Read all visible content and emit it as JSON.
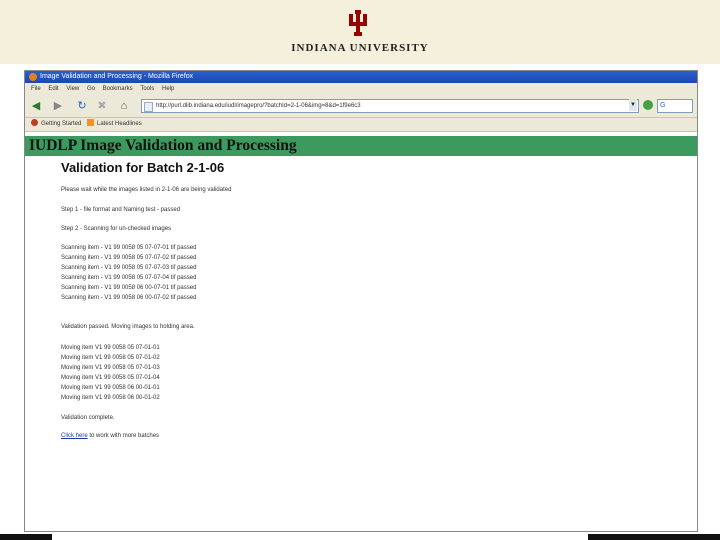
{
  "banner": {
    "university": "INDIANA UNIVERSITY"
  },
  "browser": {
    "window_title": "Image Validation and Processing - Mozilla Firefox",
    "menu": [
      "File",
      "Edit",
      "View",
      "Go",
      "Bookmarks",
      "Tools",
      "Help"
    ],
    "url": "http://purl.dlib.indiana.edu/iudl/imagepro/?batchId=2-1-06&img=8&d=1f9e6c3",
    "search_label": "G",
    "bookmarks": [
      "Getting Started",
      "Latest Headlines"
    ]
  },
  "page": {
    "app_title": "IUDLP Image Validation and Processing",
    "batch_title": "Validation for Batch 2-1-06",
    "intro": "Please wait while the images listed in 2-1-06 are being validated",
    "step1": "Step 1 - file format and Naming test - passed",
    "step2": "Step 2 - Scanning for un-checked images",
    "scan_results": [
      "Scanning item - V1 99 0058 05 07-07-01 tif passed",
      "Scanning item - V1 99 0058 05 07-07-02 tif passed",
      "Scanning item - V1 99 0058 05 07-07-03 tif passed",
      "Scanning item - V1 99 0058 05 07-07-04 tif passed",
      "Scanning item - V1 99 0058 06 00-07-01 tif passed",
      "Scanning item - V1 99 0058 06 00-07-02 tif passed"
    ],
    "validation_passed": "Validation passed. Moving images to holding area.",
    "moves": [
      "Moving item V1 99 0058 05 07-01-01",
      "Moving item V1 99 0058 05 07-01-02",
      "Moving item V1 99 0058 05 07-01-03",
      "Moving item V1 99 0058 05 07-01-04",
      "Moving item V1 99 0058 06 00-01-01",
      "Moving item V1 99 0058 06 00-01-02"
    ],
    "complete": "Validation complete.",
    "link_text": "Click here",
    "link_suffix": " to work with more batches"
  },
  "colors": {
    "header_bar": "#3c9a5f",
    "iu_crimson": "#990000",
    "banner_bg": "#f5f0dc"
  }
}
